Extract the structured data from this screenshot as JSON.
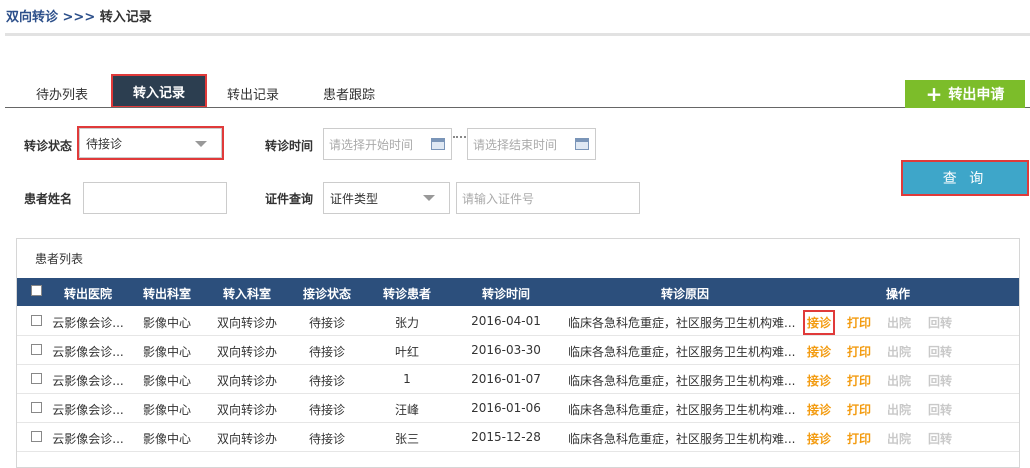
{
  "breadcrumb": {
    "root": "双向转诊",
    "separator": " >>> ",
    "current": "转入记录"
  },
  "tabs": [
    {
      "label": "待办列表"
    },
    {
      "label": "转入记录",
      "active": true
    },
    {
      "label": "转出记录"
    },
    {
      "label": "患者跟踪"
    }
  ],
  "transfer_button": {
    "icon": "plus-icon",
    "label": "转出申请"
  },
  "filters": {
    "status_label": "转诊状态",
    "status_value": "待接诊",
    "time_label": "转诊时间",
    "start_placeholder": "请选择开始时间",
    "end_placeholder": "请选择结束时间",
    "name_label": "患者姓名",
    "name_value": "",
    "id_label": "证件查询",
    "id_type_value": "证件类型",
    "id_placeholder": "请输入证件号",
    "query_label": "查 询"
  },
  "table": {
    "panel_title": "患者列表",
    "headers": [
      "转出医院",
      "转出科室",
      "转入科室",
      "接诊状态",
      "转诊患者",
      "转诊时间",
      "转诊原因",
      "操作"
    ],
    "actions": [
      "接诊",
      "打印",
      "出院",
      "回转"
    ],
    "rows": [
      {
        "hospital": "云影像会诊...",
        "out_dept": "影像中心",
        "in_dept": "双向转诊办",
        "status": "待接诊",
        "patient": "张力",
        "time": "2016-04-01",
        "reason": "临床各急科危重症，社区服务卫生机构难..."
      },
      {
        "hospital": "云影像会诊...",
        "out_dept": "影像中心",
        "in_dept": "双向转诊办",
        "status": "待接诊",
        "patient": "叶红",
        "time": "2016-03-30",
        "reason": "临床各急科危重症，社区服务卫生机构难..."
      },
      {
        "hospital": "云影像会诊...",
        "out_dept": "影像中心",
        "in_dept": "双向转诊办",
        "status": "待接诊",
        "patient": "1",
        "time": "2016-01-07",
        "reason": "临床各急科危重症，社区服务卫生机构难..."
      },
      {
        "hospital": "云影像会诊...",
        "out_dept": "影像中心",
        "in_dept": "双向转诊办",
        "status": "待接诊",
        "patient": "汪峰",
        "time": "2016-01-06",
        "reason": "临床各急科危重症，社区服务卫生机构难..."
      },
      {
        "hospital": "云影像会诊...",
        "out_dept": "影像中心",
        "in_dept": "双向转诊办",
        "status": "待接诊",
        "patient": "张三",
        "time": "2015-12-28",
        "reason": "临床各急科危重症，社区服务卫生机构难..."
      }
    ]
  },
  "colors": {
    "header_bg": "#2c4f7c",
    "active_tab_bg": "#2c3e50",
    "transfer_btn_bg": "#7cbd2a",
    "query_btn_bg": "#3ea6c9",
    "action_orange": "#f39c12",
    "action_gray": "#c9c9c9",
    "highlight_red": "#e03a3a"
  }
}
